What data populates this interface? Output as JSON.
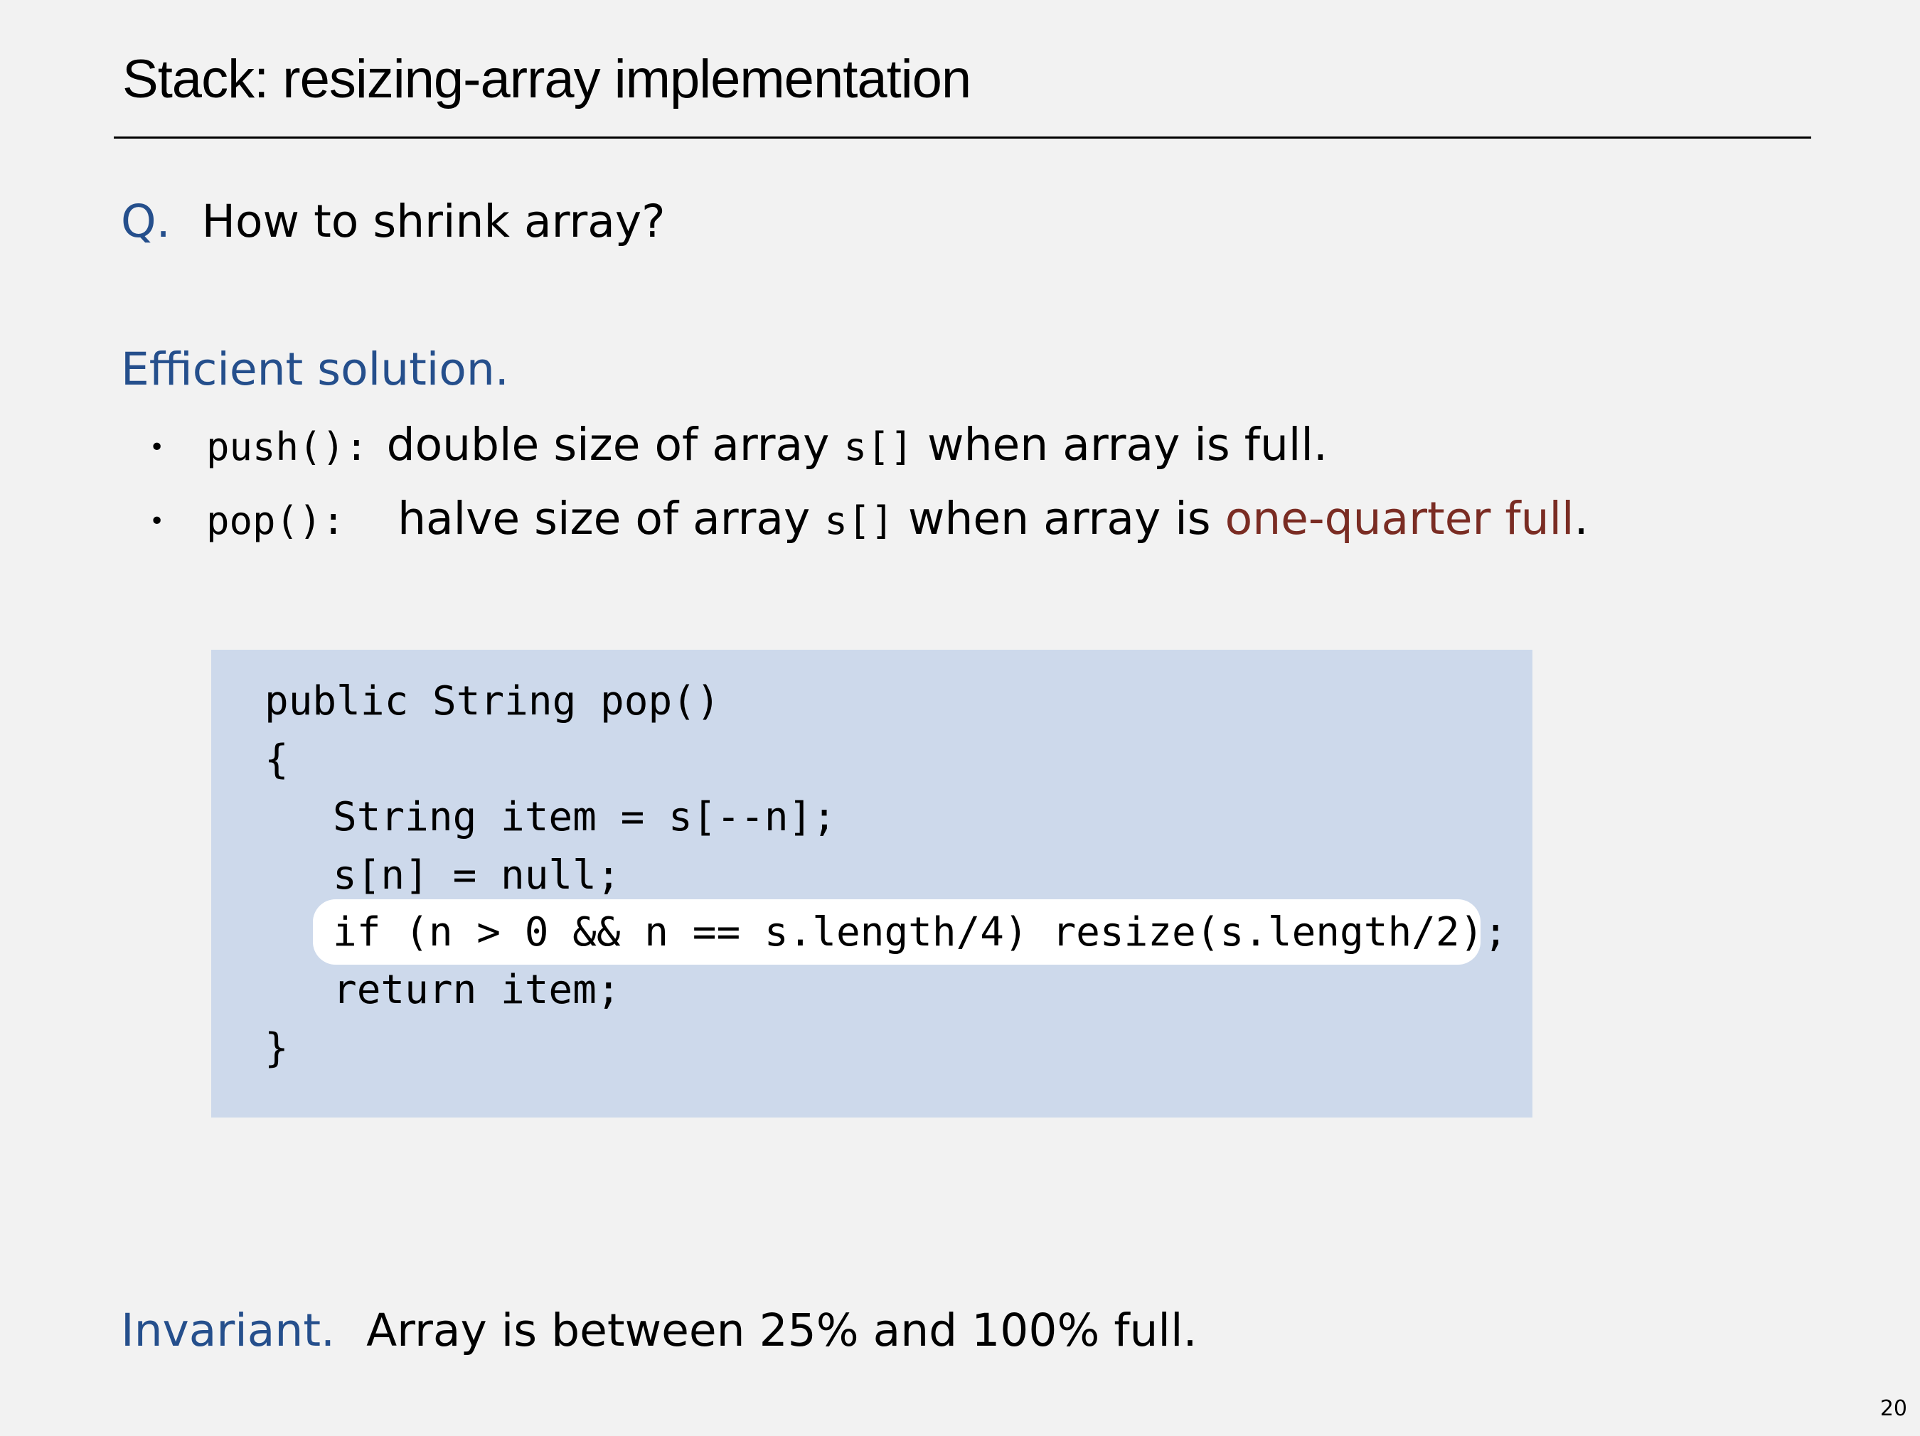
{
  "slide": {
    "title": "Stack:  resizing-array implementation",
    "page_number": "20"
  },
  "question": {
    "label": "Q.",
    "text": "How to shrink array?"
  },
  "solution": {
    "heading": "Efficient solution.",
    "bullets": [
      {
        "code": "push():",
        "text_before": "double size of array ",
        "code_inline": "s[]",
        "text_after": " when array is full.",
        "highlight": "",
        "end": ""
      },
      {
        "code": "pop():",
        "text_before": "halve size of array ",
        "code_inline": "s[]",
        "text_after": " when array is ",
        "highlight": "one-quarter full",
        "end": "."
      }
    ]
  },
  "code": {
    "lines": [
      "public String pop()",
      "{",
      "String item = s[--n];",
      "s[n] = null;",
      "if (n > 0 && n == s.length/4) resize(s.length/2);",
      "return item;",
      "}"
    ],
    "highlighted_line": 4
  },
  "invariant": {
    "label": "Invariant.",
    "text": "Array is between 25% and 100% full."
  },
  "colors": {
    "accent_blue": "#254f8c",
    "accent_red": "#7a2c23",
    "code_background": "#cdd9eb",
    "highlight_background": "#ffffff",
    "page_background": "#f2f2f2"
  }
}
